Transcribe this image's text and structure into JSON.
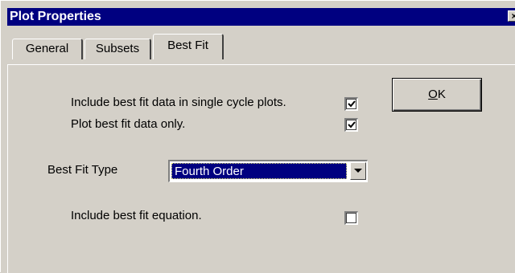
{
  "window": {
    "title": "Plot Properties",
    "close_glyph": "×"
  },
  "tabs": [
    {
      "label": "General",
      "active": false
    },
    {
      "label": "Subsets",
      "active": false
    },
    {
      "label": "Best Fit",
      "active": true
    }
  ],
  "best_fit": {
    "include_single_cycle": {
      "label": "Include best fit data in single cycle plots.",
      "checked": true
    },
    "plot_only": {
      "label": "Plot best fit data only.",
      "checked": true
    },
    "type": {
      "label": "Best Fit Type",
      "selected": "Fourth Order"
    },
    "include_equation": {
      "label": "Include best fit equation.",
      "checked": false
    }
  },
  "buttons": {
    "ok_mnemonic": "O",
    "ok_rest": "K"
  },
  "icons": {
    "close": "close-icon",
    "checkmark": "checkmark-icon",
    "dropdown": "chevron-down-icon"
  },
  "colors": {
    "titlebar": "#000080",
    "face": "#d4d0c8",
    "selection": "#000080"
  }
}
